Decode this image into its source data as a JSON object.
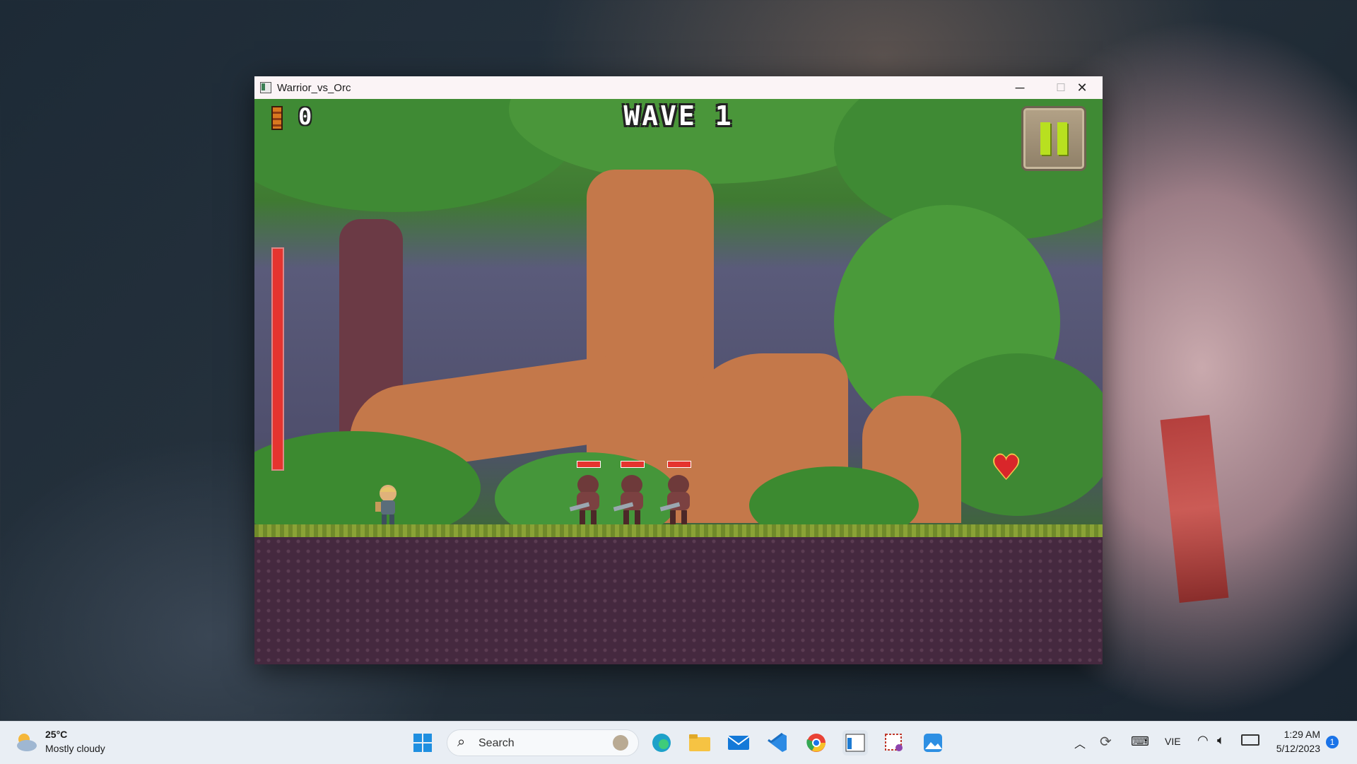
{
  "window": {
    "title": "Warrior_vs_Orc",
    "controls": {
      "minimize": "─",
      "maximize": "☐",
      "close": "✕"
    }
  },
  "game": {
    "score": "0",
    "wave_label": "WAVE 1",
    "player_health": 1.0,
    "enemies": [
      {
        "name": "orc",
        "health": 1.0
      },
      {
        "name": "orc",
        "health": 1.0
      },
      {
        "name": "orc",
        "health": 1.0
      }
    ],
    "pickup": "heart-pickup",
    "colors": {
      "health": "#e5342f",
      "pause_bars": "#b8e020"
    }
  },
  "taskbar": {
    "weather": {
      "temp": "25°C",
      "condition": "Mostly cloudy"
    },
    "search_label": "Search",
    "language": "VIE",
    "time": "1:29 AM",
    "date": "5/12/2023",
    "notification_count": "1",
    "apps": [
      "start-icon",
      "edge-icon",
      "file-explorer-icon",
      "mail-icon",
      "vscode-icon",
      "chrome-icon",
      "game-window-icon",
      "snipping-tool-icon",
      "photos-icon"
    ]
  }
}
